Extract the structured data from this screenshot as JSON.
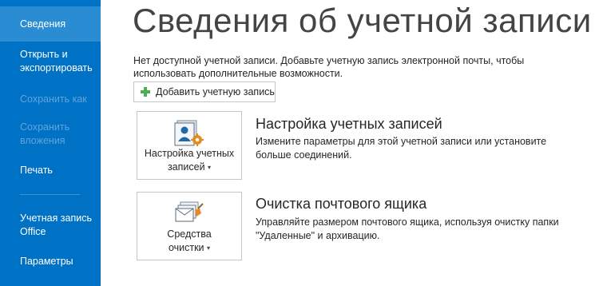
{
  "sidebar": {
    "items": [
      {
        "label": "Сведения"
      },
      {
        "label": "Открыть и экспортировать"
      },
      {
        "label": "Сохранить как"
      },
      {
        "label": "Сохранить вложения"
      },
      {
        "label": "Печать"
      },
      {
        "label": "Учетная запись Office"
      },
      {
        "label": "Параметры"
      }
    ]
  },
  "main": {
    "title": "Сведения об учетной записи",
    "no_account_text": "Нет доступной учетной записи. Добавьте учетную запись электронной почты, чтобы использовать дополнительные возможности.",
    "add_account_button": "Добавить учетную запись",
    "sections": [
      {
        "tile_line1": "Настройка учетных",
        "tile_line2": "записей",
        "title": "Настройка учетных записей",
        "description": "Измените параметры для этой учетной записи или установите больше соединений."
      },
      {
        "tile_line1": "Средства",
        "tile_line2": "очистки",
        "title": "Очистка почтового ящика",
        "description": "Управляйте размером почтового ящика, используя очистку папки \"Удаленные\" и архивацию."
      }
    ]
  },
  "colors": {
    "sidebar": "#0072c6",
    "sidebar_active": "#2a8dd4",
    "accent_green": "#4caf50",
    "icon_orange": "#e8891c"
  }
}
